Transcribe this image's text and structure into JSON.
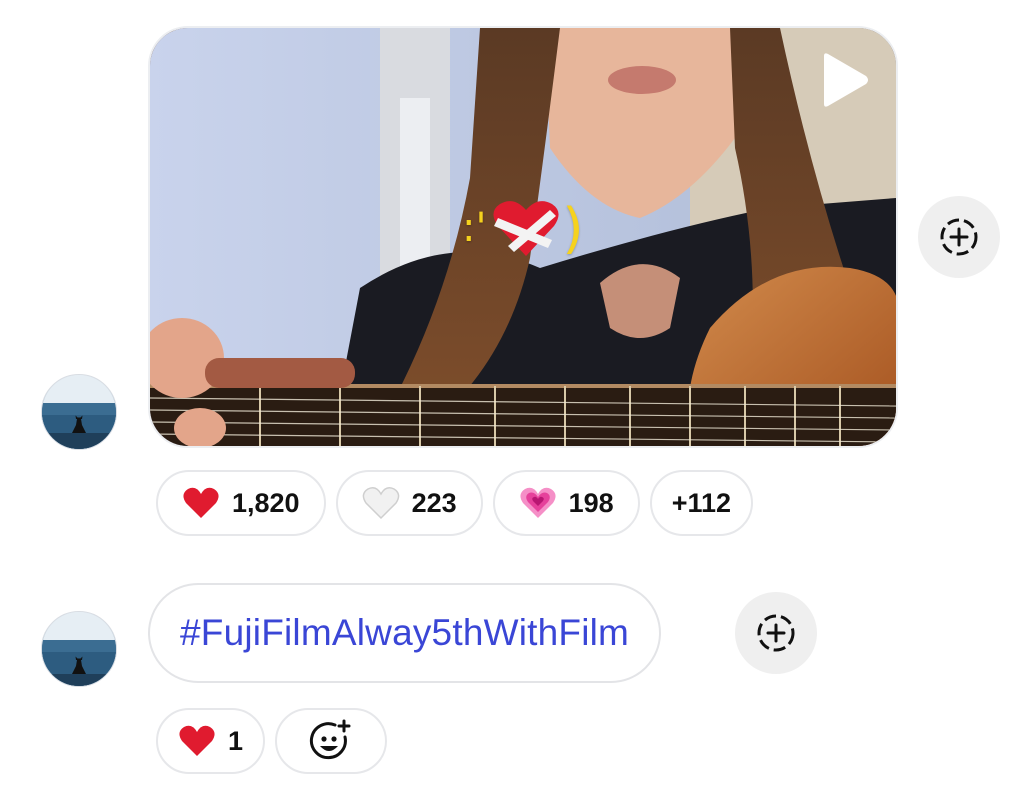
{
  "thread": {
    "media_message": {
      "sticker_left": ":'",
      "sticker_right": ")",
      "sticker_icon": "mending-heart-icon",
      "reactions": [
        {
          "icon": "red-heart-icon",
          "count": "1,820"
        },
        {
          "icon": "white-heart-icon",
          "count": "223"
        },
        {
          "icon": "growing-heart-icon",
          "count": "198"
        },
        {
          "label": "+112"
        }
      ]
    },
    "text_message": {
      "text": "#FujiFilmAlway5thWithFilm",
      "reactions": [
        {
          "icon": "red-heart-icon",
          "count": "1"
        }
      ],
      "add_reaction_icon": "smiley-plus-icon"
    },
    "action_icon": "add-circle-dashed-icon"
  },
  "colors": {
    "hashtag": "#3a46d6",
    "pill_border": "#e6e7ea",
    "action_bg": "#efefef"
  }
}
